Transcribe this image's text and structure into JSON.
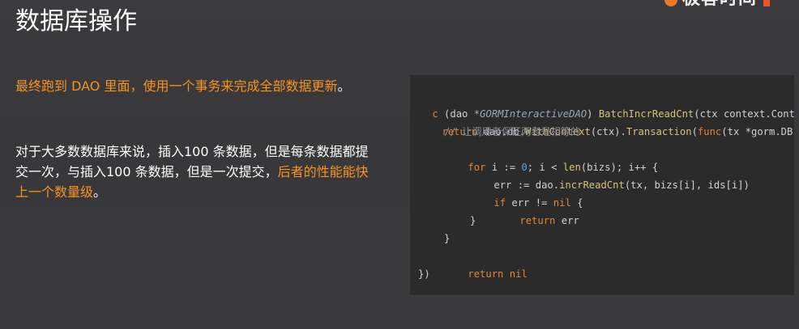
{
  "slide": {
    "title": "数据库操作",
    "logo_text": "极客时间"
  },
  "body": {
    "p1_orange": "最终跑到 DAO 里面，使用一个事务来完成全部数据更新",
    "p1_end": "。",
    "p2_white": "对于大多数数据库来说，插入100 条数据，但是每条数据都提交一次，与插入100 条数据，但是一次提交，",
    "p2_orange": "后者的性能能快上一个数量级",
    "p2_end": "。"
  },
  "code": {
    "l1": [
      "c ",
      "(dao ",
      "*GORMInteractiveDAO",
      ") ",
      "BatchIncrReadCnt",
      "(ctx ",
      "context.Context"
    ],
    "l2": [
      "return ",
      "dao.db.",
      "WithContext",
      "(ctx).",
      "Transaction",
      "(",
      "func",
      "(tx ",
      "*gorm.DB"
    ],
    "l3": "// 让调用者保证两者是相等的",
    "l4": [
      "for ",
      "i := ",
      "0",
      "; i < ",
      "len",
      "(bizs); i++ {"
    ],
    "l5": [
      "err := ",
      "dao.",
      "incrReadCnt",
      "(tx, bizs[i], ids[i])"
    ],
    "l6": [
      "if ",
      "err != ",
      "nil",
      " {"
    ],
    "l7": [
      "return ",
      "err"
    ],
    "l8": "}",
    "l9": "}",
    "l10": [
      "return ",
      "nil"
    ],
    "l11": "})"
  },
  "colors": {
    "background": "#3a3a3c",
    "accent": "#f7931e",
    "code_bg": "#2b2b2c"
  }
}
